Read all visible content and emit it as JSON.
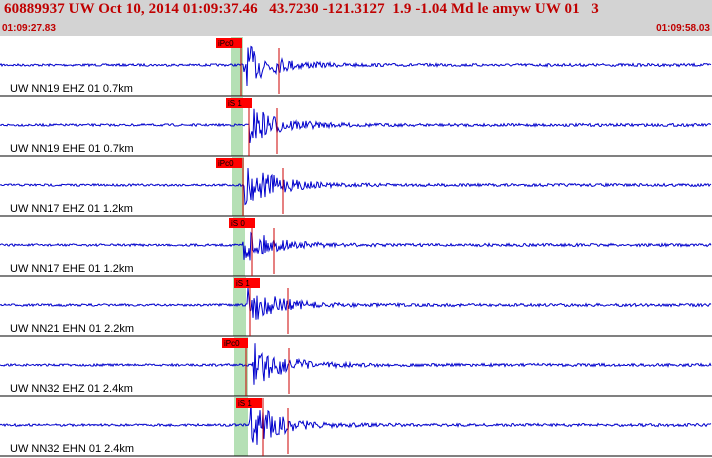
{
  "header": {
    "title": "60889937 UW Oct 10, 2014 01:09:37.46   43.7230 -121.3127  1.9 -1.04 Md le amyw UW 01   3",
    "start_time": "01:09:27.83",
    "end_time": "01:09:58.03"
  },
  "colors": {
    "header_bg": "#d3d3d3",
    "header_text": "#c00000",
    "trace": "#0000cc",
    "window": "#b5e0b5",
    "pick_box": "#ff0000",
    "pick_line": "#cc0000"
  },
  "traces": [
    {
      "label": "UW NN19 EHZ 01 0.7km",
      "pick": "iPc0"
    },
    {
      "label": "UW NN19 EHE 01 0.7km",
      "pick": "iS 1"
    },
    {
      "label": "UW NN17 EHZ 01 1.2km",
      "pick": "iPc0"
    },
    {
      "label": "UW NN17 EHE 01 1.2km",
      "pick": "iS 0"
    },
    {
      "label": "UW NN21 EHN 01 2.2km",
      "pick": "iS 1"
    },
    {
      "label": "UW NN32 EHZ 01 2.4km",
      "pick": "iPc0"
    },
    {
      "label": "UW NN32 EHN 01 2.4km",
      "pick": "iS 1"
    }
  ]
}
